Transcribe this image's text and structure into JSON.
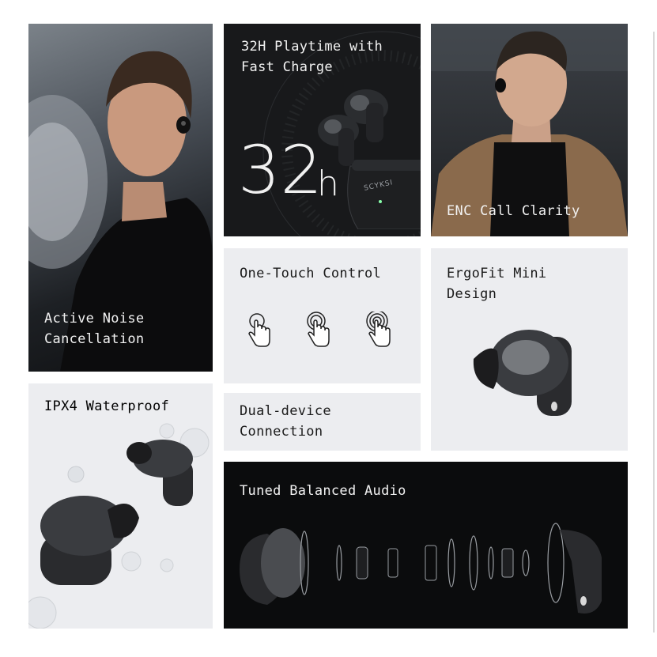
{
  "tiles": {
    "anc": {
      "label": "Active Noise\nCancellation"
    },
    "playtime": {
      "label": "32H Playtime with\nFast Charge",
      "big_number": "32",
      "big_unit": "h",
      "case_brand": "SCYKSI"
    },
    "enc": {
      "label": "ENC Call Clarity"
    },
    "touch": {
      "label": "One-Touch Control"
    },
    "ergofit": {
      "label": "ErgoFit Mini\nDesign"
    },
    "ipx4": {
      "label": "IPX4 Waterproof"
    },
    "dual": {
      "label": "Dual-device\nConnection"
    },
    "audio": {
      "label": "Tuned Balanced Audio"
    }
  },
  "icons": [
    "hand-tap-icon",
    "hand-double-tap-icon",
    "hand-triple-tap-icon"
  ],
  "colors": {
    "dark_tile": "#111214",
    "light_tile": "#ecedf0",
    "text_light": "#f2f2f2",
    "text_dark": "#1a1a1a"
  }
}
